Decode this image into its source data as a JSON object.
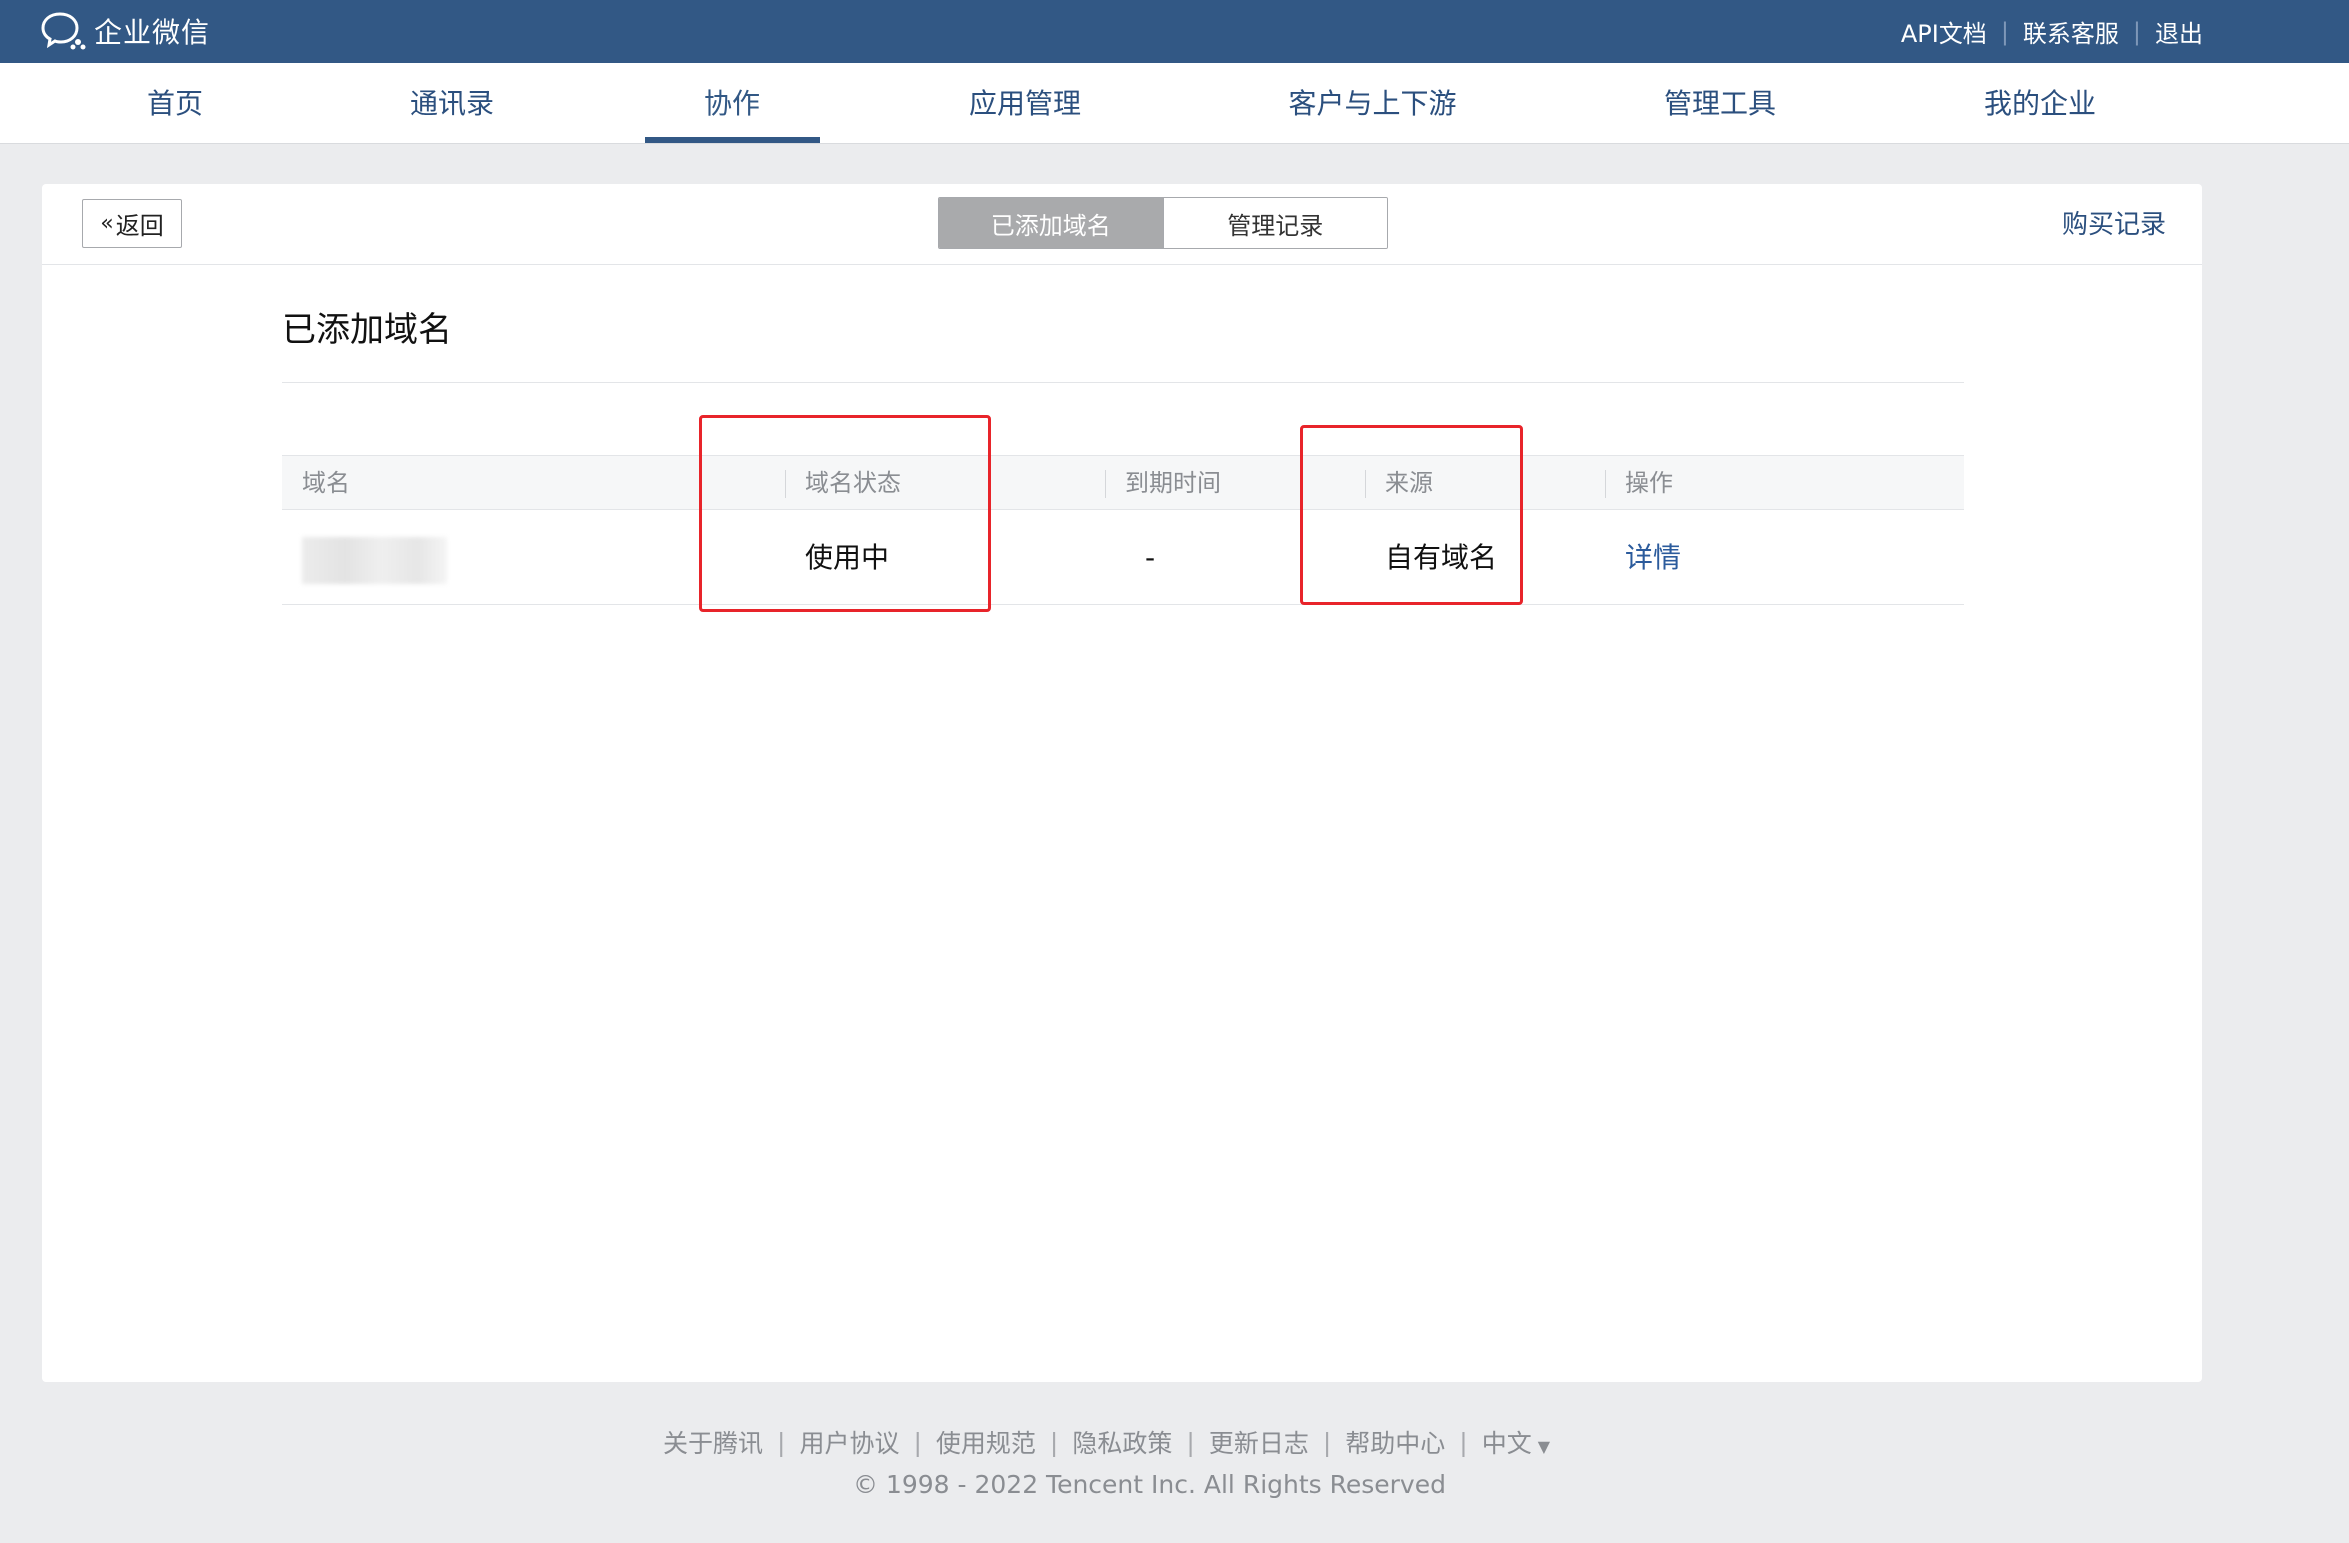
{
  "app": {
    "title": "企业微信"
  },
  "toplinks": {
    "api_docs": "API文档",
    "support": "联系客服",
    "logout": "退出"
  },
  "nav": {
    "items": [
      {
        "label": "首页"
      },
      {
        "label": "通讯录"
      },
      {
        "label": "协作"
      },
      {
        "label": "应用管理"
      },
      {
        "label": "客户与上下游"
      },
      {
        "label": "管理工具"
      },
      {
        "label": "我的企业"
      }
    ],
    "active": "协作"
  },
  "card": {
    "back_label": "返回",
    "tabs": [
      {
        "label": "已添加域名"
      },
      {
        "label": "管理记录"
      }
    ],
    "active_tab": "已添加域名",
    "purchase_link": "购买记录",
    "section_title": "已添加域名"
  },
  "table": {
    "headers": {
      "domain": "域名",
      "status": "域名状态",
      "expire": "到期时间",
      "source": "来源",
      "action": "操作"
    },
    "rows": [
      {
        "domain": "",
        "status": "使用中",
        "expire": "-",
        "source": "自有域名",
        "action": "详情"
      }
    ]
  },
  "footer": {
    "links": [
      "关于腾讯",
      "用户协议",
      "使用规范",
      "隐私政策",
      "更新日志",
      "帮助中心"
    ],
    "language": "中文",
    "copyright": "© 1998 - 2022 Tencent Inc. All Rights Reserved"
  },
  "colors": {
    "topbar": "#325885",
    "highlight": "#e8242a",
    "link": "#2b5b9c"
  }
}
